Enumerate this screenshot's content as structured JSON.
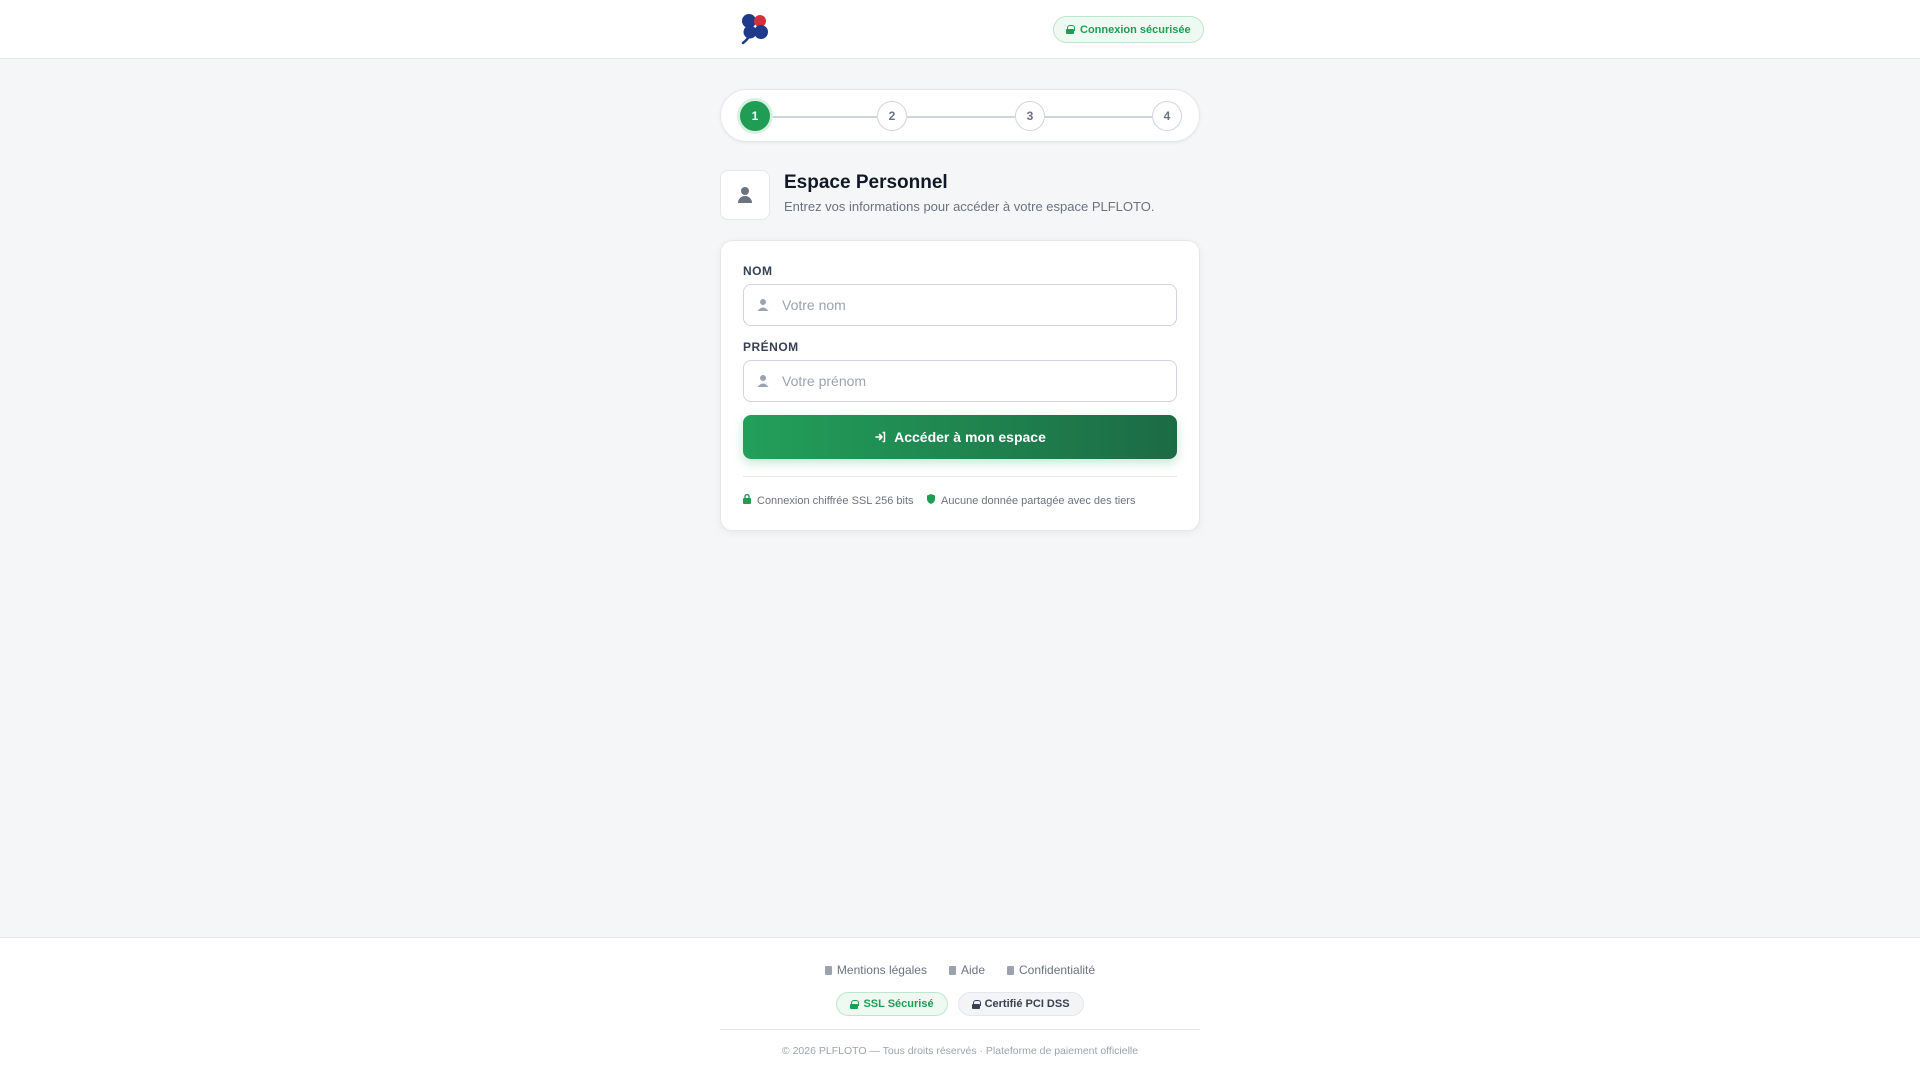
{
  "header": {
    "logo_name": "clover-logo",
    "secure_label": "Connexion sécurisée"
  },
  "stepper": {
    "steps": [
      "1",
      "2",
      "3",
      "4"
    ],
    "active_step": 1
  },
  "page": {
    "title": "Espace Personnel",
    "subtitle": "Entrez vos informations pour accéder à votre espace PLFLOTO."
  },
  "form": {
    "nom": {
      "label": "NOM",
      "placeholder": "Votre nom",
      "value": ""
    },
    "prenom": {
      "label": "PRÉNOM",
      "placeholder": "Votre prénom",
      "value": ""
    },
    "submit_label": "Accéder à mon espace",
    "trust": [
      "Connexion chiffrée SSL 256 bits",
      "Aucune donnée partagée avec des tiers"
    ]
  },
  "footer": {
    "links": [
      "Mentions légales",
      "Aide",
      "Confidentialité"
    ],
    "badges": [
      "SSL Sécurisé",
      "Certifié PCI DSS"
    ],
    "copyright": "© 2026 PLFLOTO — Tous droits réservés · Plateforme de paiement officielle"
  },
  "colors": {
    "accent": "#1f9d55",
    "accent_dark": "#1c6b45",
    "background": "#f5f6f7",
    "logo_blue": "#1f3a8a",
    "logo_red": "#d1323a"
  }
}
